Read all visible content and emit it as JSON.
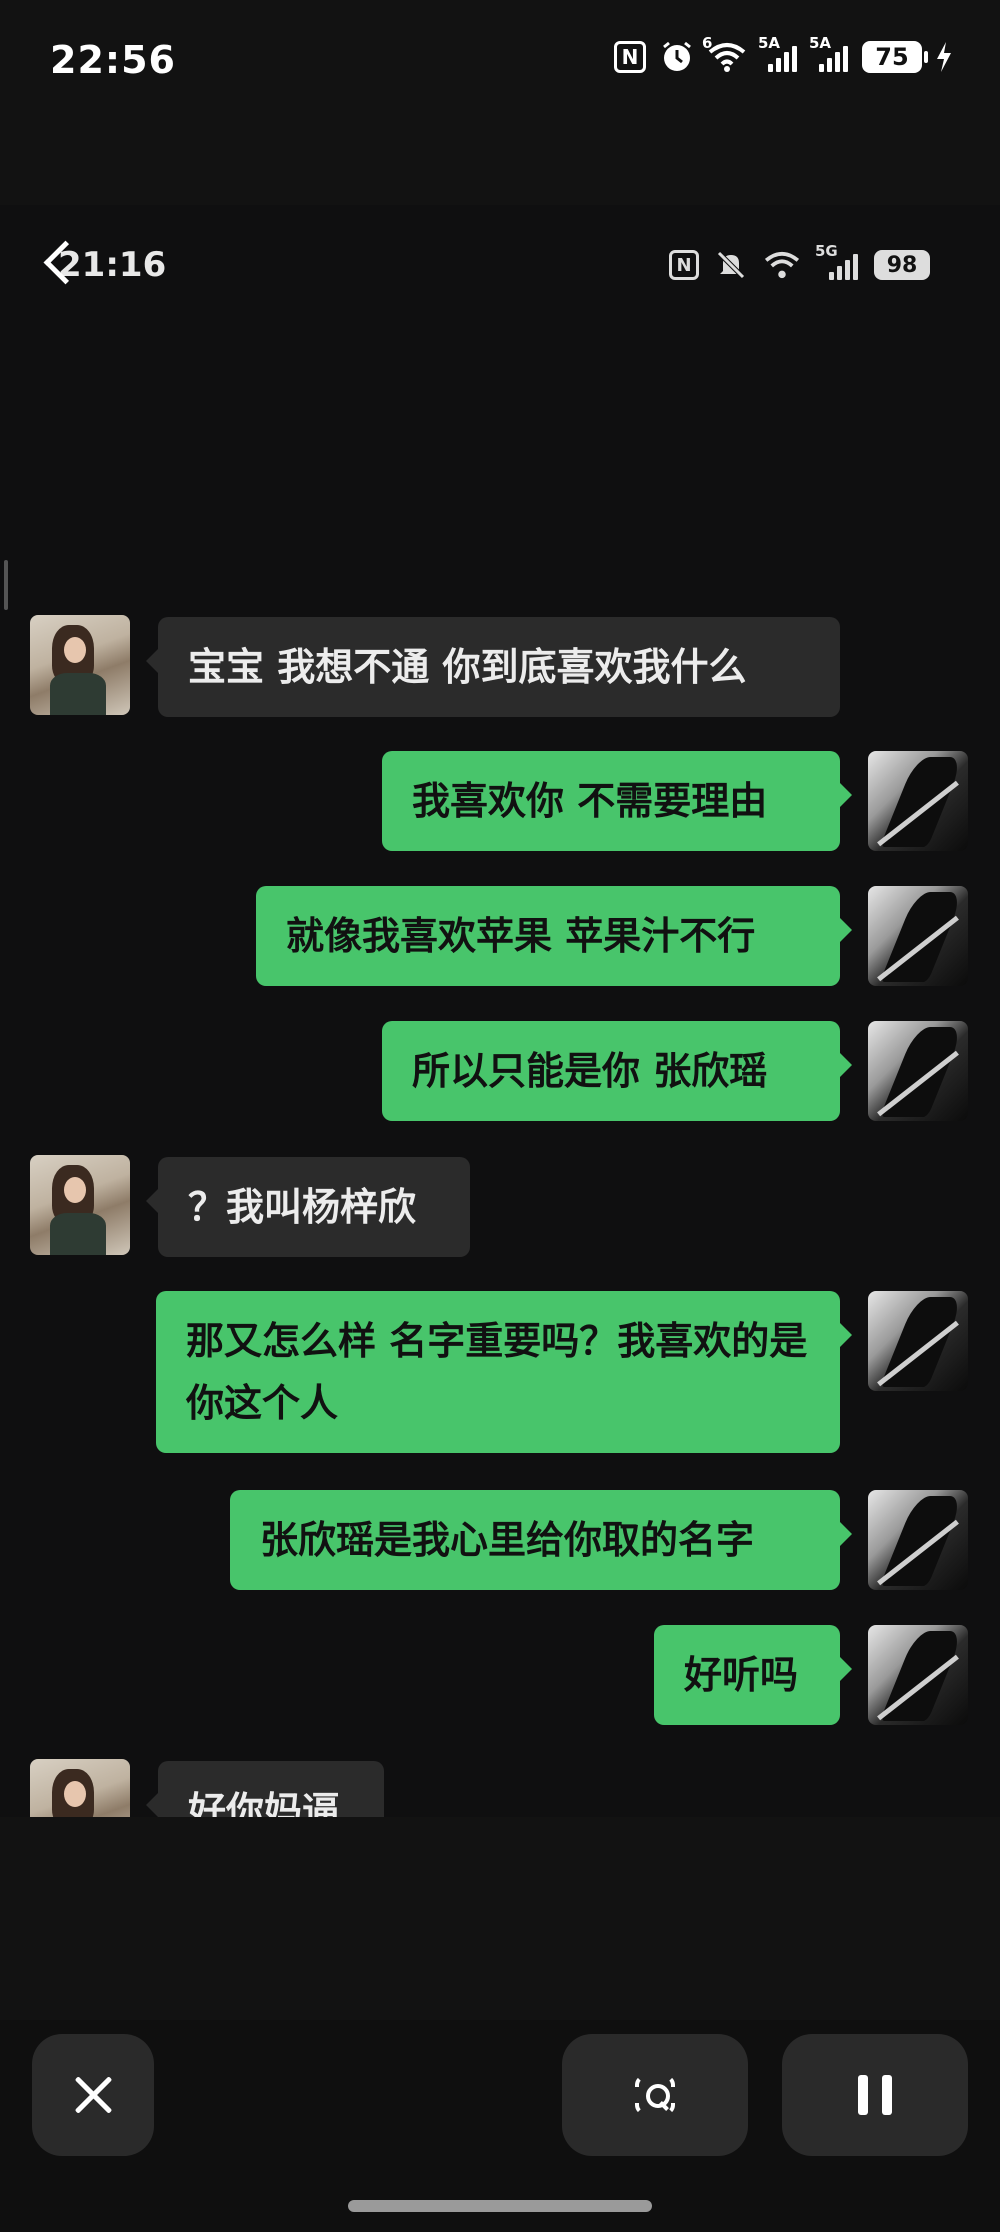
{
  "outer_status": {
    "time": "22:56",
    "network_6": "6",
    "sim1": "5A",
    "sim2": "5A",
    "battery": "75"
  },
  "inner_status": {
    "time": "21:16",
    "network": "5G",
    "battery": "98"
  },
  "messages": [
    {
      "side": "in",
      "text": "宝宝  我想不通  你到底喜欢我什么"
    },
    {
      "side": "out",
      "text": "我喜欢你  不需要理由"
    },
    {
      "side": "out",
      "text": "就像我喜欢苹果  苹果汁不行"
    },
    {
      "side": "out",
      "text": "所以只能是你  张欣瑶"
    },
    {
      "side": "in",
      "text": "？我叫杨梓欣"
    },
    {
      "side": "out",
      "text": "那又怎么样  名字重要吗？我喜欢的是你这个人"
    },
    {
      "side": "out",
      "text": "张欣瑶是我心里给你取的名字"
    },
    {
      "side": "out",
      "text": "好听吗"
    },
    {
      "side": "in",
      "text": "好你妈逼"
    }
  ],
  "icons": {
    "outer": [
      "nfc-icon",
      "alarm-icon",
      "wifi-icon",
      "signal-icon",
      "signal-icon",
      "battery-icon",
      "charging-icon"
    ],
    "inner": [
      "nfc-icon",
      "mute-icon",
      "wifi-icon",
      "signal-icon",
      "battery-icon"
    ]
  },
  "colors": {
    "outgoing_bubble": "#48c56b",
    "incoming_bubble": "#2b2b2b"
  }
}
